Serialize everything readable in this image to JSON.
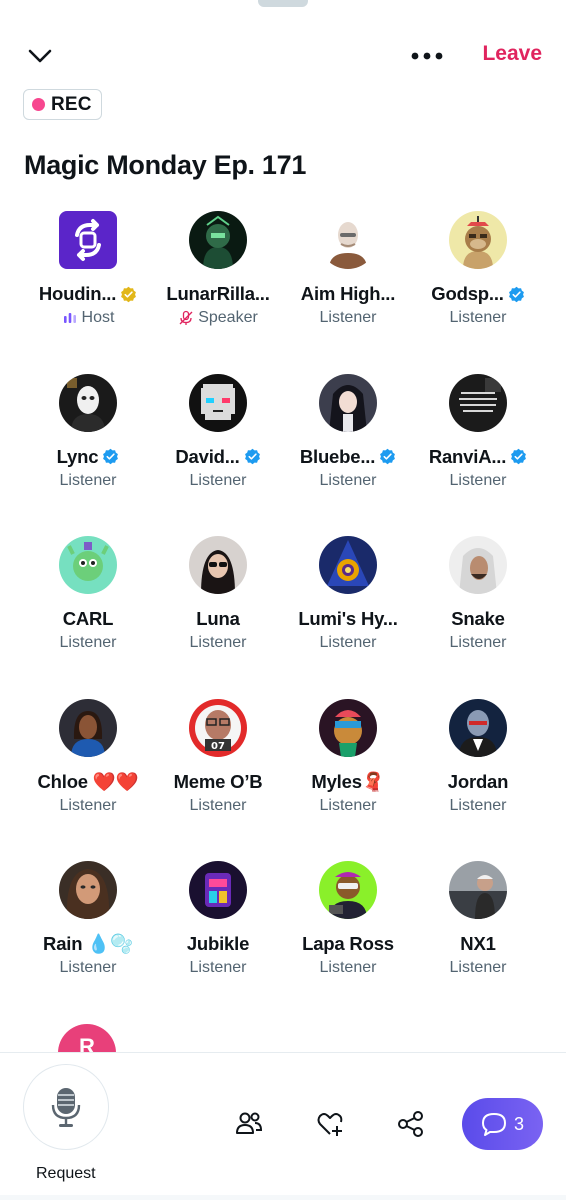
{
  "header": {
    "leave_label": "Leave",
    "rec_label": "REC"
  },
  "space": {
    "title": "Magic Monday Ep. 171"
  },
  "participants": [
    {
      "name": "Houdin...",
      "role": "Host",
      "badge": "gold",
      "avatar": "swap-logo"
    },
    {
      "name": "LunarRilla...",
      "role": "Speaker",
      "badge": "",
      "avatar": "green-gorilla"
    },
    {
      "name": "Aim High...",
      "role": "Listener",
      "badge": "",
      "avatar": "man-portrait"
    },
    {
      "name": "Godsp...",
      "role": "Listener",
      "badge": "blue",
      "avatar": "bored-ape"
    },
    {
      "name": "Lync",
      "role": "Listener",
      "badge": "blue",
      "avatar": "masked-figure"
    },
    {
      "name": "David...",
      "role": "Listener",
      "badge": "blue",
      "avatar": "pixel-face"
    },
    {
      "name": "Bluebe...",
      "role": "Listener",
      "badge": "blue",
      "avatar": "anime-girl"
    },
    {
      "name": "RanviA...",
      "role": "Listener",
      "badge": "blue",
      "avatar": "quote-text"
    },
    {
      "name": "CARL",
      "role": "Listener",
      "badge": "",
      "avatar": "green-creature"
    },
    {
      "name": "Luna",
      "role": "Listener",
      "badge": "",
      "avatar": "woman-sunglasses"
    },
    {
      "name": "Lumi's Hy...",
      "role": "Listener",
      "badge": "",
      "avatar": "wizard"
    },
    {
      "name": "Snake",
      "role": "Listener",
      "badge": "",
      "avatar": "hooded-man"
    },
    {
      "name": "Chloe ❤️❤️",
      "role": "Listener",
      "badge": "",
      "avatar": "woman-portrait"
    },
    {
      "name": "Meme O’B",
      "role": "Listener",
      "badge": "",
      "avatar": "jersey-07"
    },
    {
      "name": "Myles🧣",
      "role": "Listener",
      "badge": "",
      "avatar": "cartoon-ape"
    },
    {
      "name": "Jordan",
      "role": "Listener",
      "badge": "",
      "avatar": "robot-suit"
    },
    {
      "name": "Rain 💧🫧",
      "role": "Listener",
      "badge": "",
      "avatar": "woman-face"
    },
    {
      "name": "Jubikle",
      "role": "Listener",
      "badge": "",
      "avatar": "neon-robot"
    },
    {
      "name": "Lapa Ross",
      "role": "Listener",
      "badge": "",
      "avatar": "gamer-ape"
    },
    {
      "name": "NX1",
      "role": "Listener",
      "badge": "",
      "avatar": "man-car"
    }
  ],
  "peek_avatar": {
    "letter": "R",
    "color": "#e8407a"
  },
  "bottom": {
    "request_label": "Request",
    "chat_count": "3"
  },
  "colors": {
    "leave": "#e0245e",
    "rec_dot": "#f7478f",
    "chat_button": "#5a4bea",
    "verified_blue": "#1d9bf0",
    "verified_gold": "#e2b719",
    "host_bars": "#7856ff"
  }
}
